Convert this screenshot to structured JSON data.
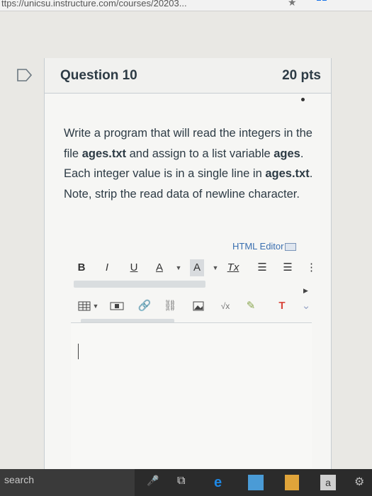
{
  "browser": {
    "url": "ttps://unicsu.instructure.com/courses/20203..."
  },
  "question": {
    "title": "Question 10",
    "points": "20 pts",
    "text_parts": [
      {
        "t": "Write a program that will read the integers in the file ",
        "b": false
      },
      {
        "t": "ages.txt",
        "b": true
      },
      {
        "t": " and assign to a list variable ",
        "b": false
      },
      {
        "t": "ages",
        "b": true
      },
      {
        "t": ". Each integer value is in a single line in ",
        "b": false
      },
      {
        "t": "ages.txt",
        "b": true
      },
      {
        "t": ". Note, strip the read data of newline character.",
        "b": false
      }
    ]
  },
  "editor": {
    "html_editor_label": "HTML Editor",
    "toolbar1": [
      "B",
      "I",
      "U",
      "A",
      "A",
      "Tx"
    ],
    "toolbar2": [
      "√x"
    ]
  },
  "taskbar": {
    "search_placeholder": "search"
  },
  "colors": {
    "link": "#3a6fb0",
    "text": "#2d3b45",
    "edge_icon": "#1e88e5"
  }
}
